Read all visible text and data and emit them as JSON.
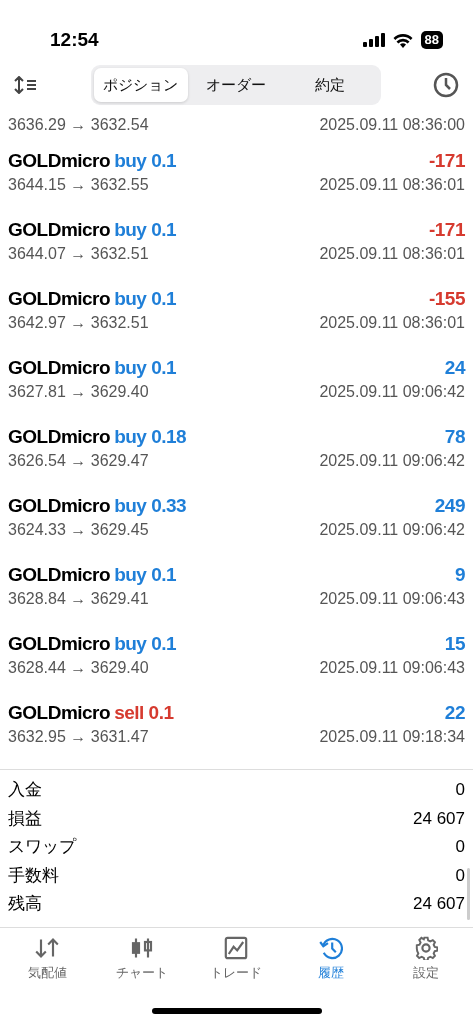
{
  "status_bar": {
    "time": "12:54",
    "battery": "88"
  },
  "tabs": [
    {
      "label": "ポジション",
      "selected": true
    },
    {
      "label": "オーダー",
      "selected": false
    },
    {
      "label": "約定",
      "selected": false
    }
  ],
  "trades": [
    {
      "prices": "3636.29 → 3632.54",
      "time": "2025.09.11 08:36:00"
    },
    {
      "symbol": "GOLDmicro",
      "side": "buy 0.1",
      "kind": "buy",
      "profit": "-171",
      "negative": true,
      "prices": "3644.15 → 3632.55",
      "time": "2025.09.11 08:36:01"
    },
    {
      "symbol": "GOLDmicro",
      "side": "buy 0.1",
      "kind": "buy",
      "profit": "-171",
      "negative": true,
      "prices": "3644.07 → 3632.51",
      "time": "2025.09.11 08:36:01"
    },
    {
      "symbol": "GOLDmicro",
      "side": "buy 0.1",
      "kind": "buy",
      "profit": "-155",
      "negative": true,
      "prices": "3642.97 → 3632.51",
      "time": "2025.09.11 08:36:01"
    },
    {
      "symbol": "GOLDmicro",
      "side": "buy 0.1",
      "kind": "buy",
      "profit": "24",
      "negative": false,
      "prices": "3627.81 → 3629.40",
      "time": "2025.09.11 09:06:42"
    },
    {
      "symbol": "GOLDmicro",
      "side": "buy 0.18",
      "kind": "buy",
      "profit": "78",
      "negative": false,
      "prices": "3626.54 → 3629.47",
      "time": "2025.09.11 09:06:42"
    },
    {
      "symbol": "GOLDmicro",
      "side": "buy 0.33",
      "kind": "buy",
      "profit": "249",
      "negative": false,
      "prices": "3624.33 → 3629.45",
      "time": "2025.09.11 09:06:42"
    },
    {
      "symbol": "GOLDmicro",
      "side": "buy 0.1",
      "kind": "buy",
      "profit": "9",
      "negative": false,
      "prices": "3628.84 → 3629.41",
      "time": "2025.09.11 09:06:43"
    },
    {
      "symbol": "GOLDmicro",
      "side": "buy 0.1",
      "kind": "buy",
      "profit": "15",
      "negative": false,
      "prices": "3628.44 → 3629.40",
      "time": "2025.09.11 09:06:43"
    },
    {
      "symbol": "GOLDmicro",
      "side": "sell 0.1",
      "kind": "sell",
      "profit": "22",
      "negative": false,
      "prices": "3632.95 → 3631.47",
      "time": "2025.09.11 09:18:34"
    }
  ],
  "summary": [
    {
      "label": "入金",
      "value": "0"
    },
    {
      "label": "損益",
      "value": "24 607"
    },
    {
      "label": "スワップ",
      "value": "0"
    },
    {
      "label": "手数料",
      "value": "0"
    },
    {
      "label": "残高",
      "value": "24 607"
    }
  ],
  "nav": [
    {
      "label": "気配値",
      "selected": false
    },
    {
      "label": "チャート",
      "selected": false
    },
    {
      "label": "トレード",
      "selected": false
    },
    {
      "label": "履歴",
      "selected": true
    },
    {
      "label": "設定",
      "selected": false
    }
  ]
}
